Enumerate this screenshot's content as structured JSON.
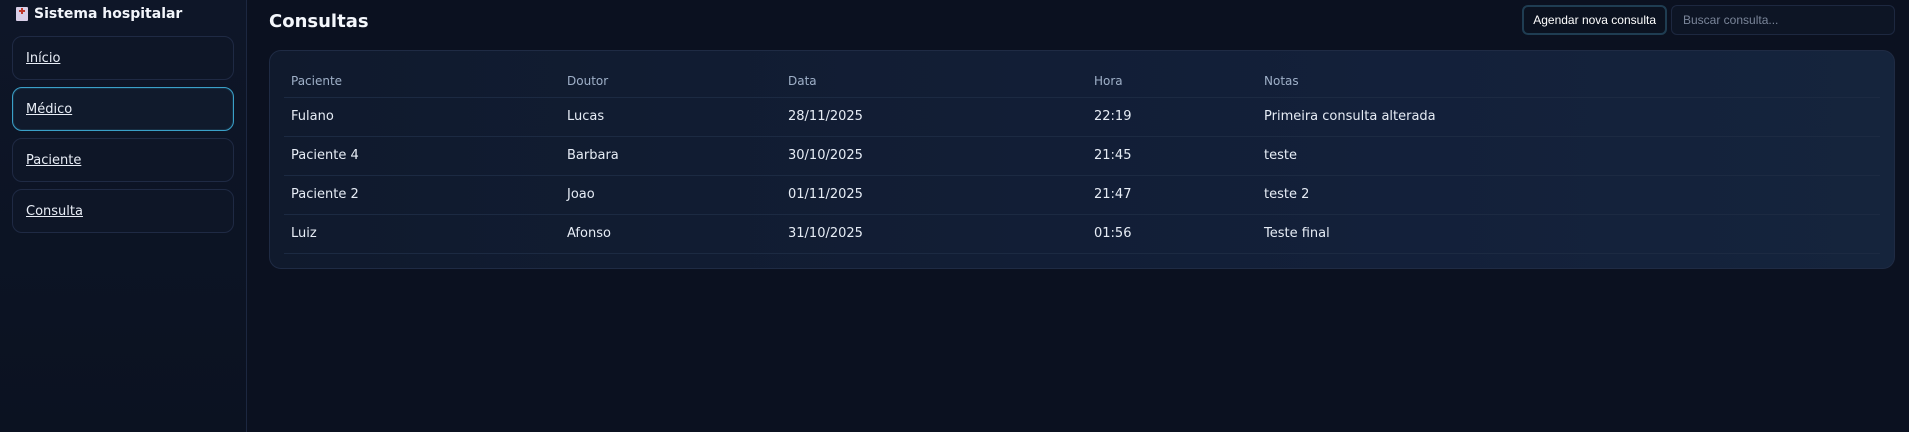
{
  "sidebar": {
    "brand": "Sistema hospitalar",
    "items": [
      {
        "label": "Início"
      },
      {
        "label": "Médico"
      },
      {
        "label": "Paciente"
      },
      {
        "label": "Consulta"
      }
    ]
  },
  "header": {
    "title": "Consultas",
    "new_button": "Agendar nova consulta",
    "search_placeholder": "Buscar consulta..."
  },
  "table": {
    "columns": [
      "Paciente",
      "Doutor",
      "Data",
      "Hora",
      "Notas"
    ],
    "rows": [
      [
        "Fulano",
        "Lucas",
        "28/11/2025",
        "22:19",
        "Primeira consulta alterada"
      ],
      [
        "Paciente 4",
        "Barbara",
        "30/10/2025",
        "21:45",
        "teste"
      ],
      [
        "Paciente 2",
        "Joao",
        "01/11/2025",
        "21:47",
        "teste 2"
      ],
      [
        "Luiz",
        "Afonso",
        "31/10/2025",
        "01:56",
        "Teste final"
      ]
    ]
  },
  "colors": {
    "background": "#0b1120",
    "active_border": "#3aa0c8"
  }
}
